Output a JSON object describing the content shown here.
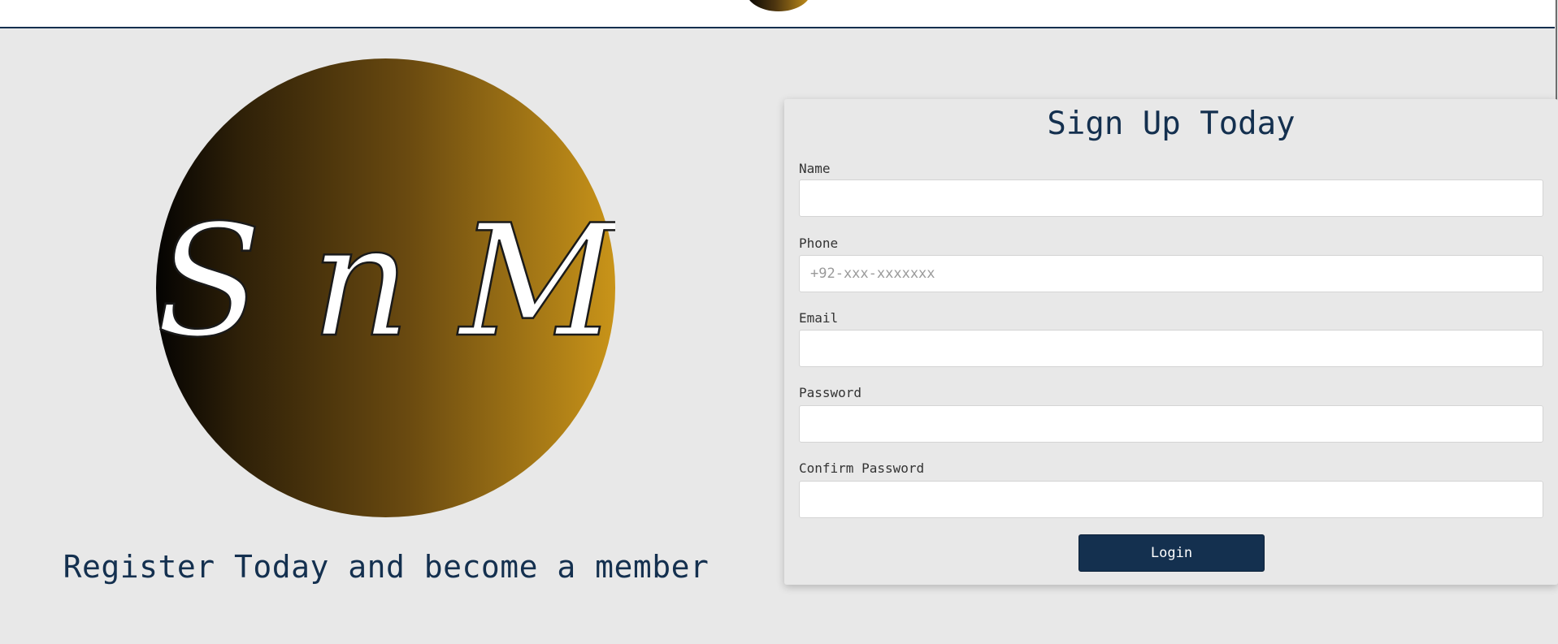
{
  "header": {
    "logo_icon": "snm-logo-icon"
  },
  "hero": {
    "logo_text": "S n M",
    "logo_icon": "snm-logo-icon",
    "tagline": "Register Today and become a member"
  },
  "form": {
    "title": "Sign Up Today",
    "fields": [
      {
        "label": "Name",
        "value": "",
        "placeholder": ""
      },
      {
        "label": "Phone",
        "value": "",
        "placeholder": "+92-xxx-xxxxxxx"
      },
      {
        "label": "Email",
        "value": "",
        "placeholder": ""
      },
      {
        "label": "Password",
        "value": "",
        "placeholder": ""
      },
      {
        "label": "Confirm Password",
        "value": "",
        "placeholder": ""
      }
    ],
    "submit_label": "Login"
  },
  "colors": {
    "brand_navy": "#14304f",
    "background": "#e8e8e8",
    "gold": "#c99419"
  }
}
